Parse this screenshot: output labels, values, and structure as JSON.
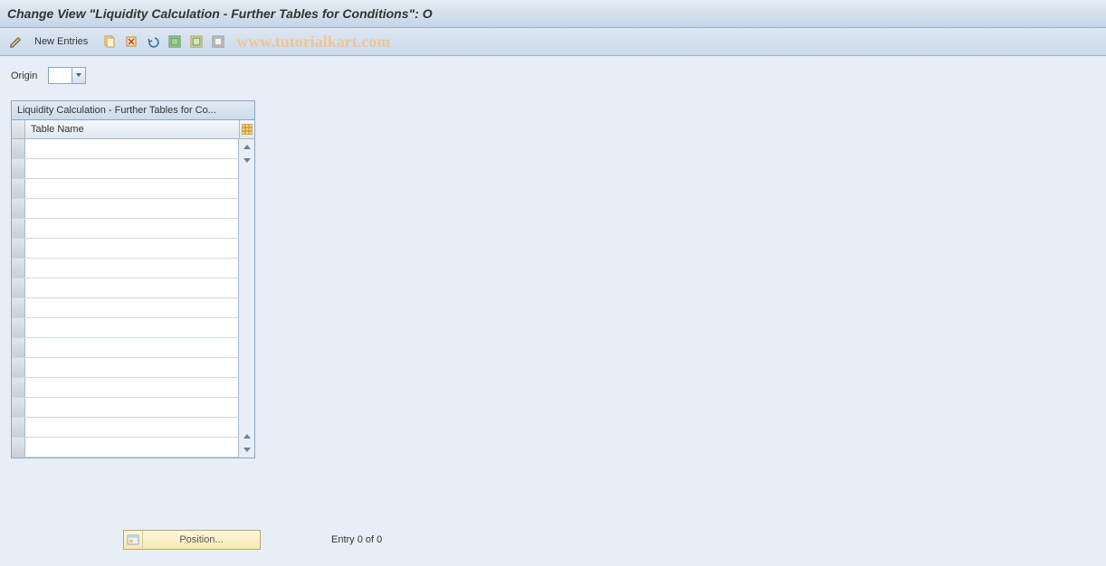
{
  "header": {
    "title": "Change View \"Liquidity Calculation - Further Tables for Conditions\": O"
  },
  "toolbar": {
    "new_entries_label": "New Entries"
  },
  "watermark": "www.tutorialkart.com",
  "form": {
    "origin_label": "Origin",
    "origin_value": ""
  },
  "table": {
    "title": "Liquidity Calculation - Further Tables for Co...",
    "columns": [
      "Table Name"
    ],
    "rows": [
      "",
      "",
      "",
      "",
      "",
      "",
      "",
      "",
      "",
      "",
      "",
      "",
      "",
      "",
      "",
      ""
    ]
  },
  "footer": {
    "position_label": "Position...",
    "entry_text": "Entry 0 of 0"
  }
}
